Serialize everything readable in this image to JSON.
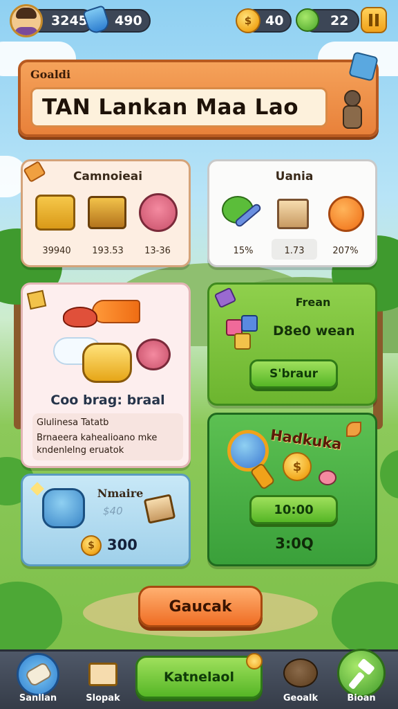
{
  "hud": {
    "player_score": "3245",
    "gems": "490",
    "coins": "40",
    "energy": "22"
  },
  "banner": {
    "subtitle": "Goaldi",
    "title": "TAN Lankan Maa Lao"
  },
  "cards": {
    "inventory": {
      "title": "Camnoieai",
      "stats": [
        "39940",
        "193.53",
        "13-36"
      ]
    },
    "market": {
      "title": "Uania",
      "stats": [
        "15%",
        "1.73",
        "207%"
      ]
    },
    "feature": {
      "title": "Coo brag: braal",
      "detail_title": "Glulinesa Tatatb",
      "detail_text_1": "Brnaeera kahealioano mke",
      "detail_text_2": "kndenlelng eruatok"
    },
    "fresh": {
      "title": "Frean",
      "reward": "D8e0 wean",
      "button": "S'braur"
    },
    "bundle": {
      "title": "Nmaire",
      "old_price": "$40",
      "price": "300"
    },
    "event": {
      "title": "Hadkuka",
      "button": "10:00",
      "timer": "3:0Q"
    }
  },
  "actions": {
    "main_button": "Gaucak"
  },
  "nav": {
    "items": [
      {
        "label": "Sanllan",
        "icon": "scroll-icon"
      },
      {
        "label": "Slopak",
        "icon": "treasure-map-icon"
      },
      {
        "label": "Katnelaol",
        "icon": "star-badge-icon"
      },
      {
        "label": "Geoalk",
        "icon": "mole-icon"
      },
      {
        "label": "Bioan",
        "icon": "hammer-icon"
      }
    ]
  },
  "colors": {
    "banner": "#e8813a",
    "green_card": "#7bc23d",
    "blue_card": "#b9dff0",
    "cream_card": "#fdeee2",
    "nav": "#3c4656"
  }
}
